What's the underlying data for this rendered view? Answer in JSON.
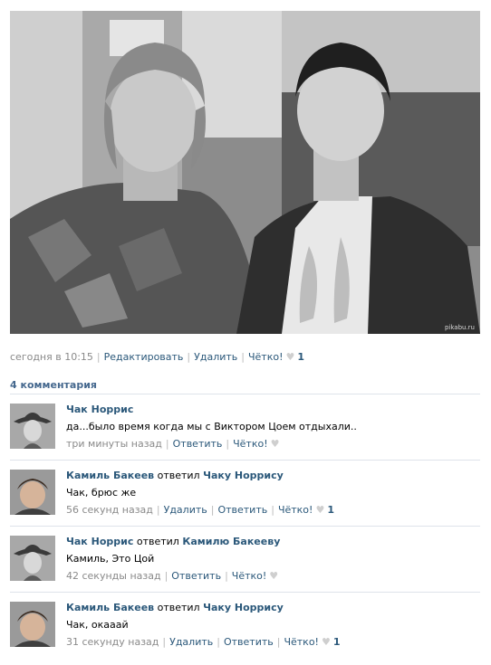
{
  "post": {
    "photo_credit": "pikabu.ru",
    "time": "сегодня в 10:15",
    "edit": "Редактировать",
    "delete": "Удалить",
    "like": "Чётко!",
    "likes_count": "1"
  },
  "comments_title": "4 комментария",
  "comments": [
    {
      "author": "Чак Норрис",
      "reply_word": "",
      "reply_to": "",
      "text": "да...было время когда мы с Виктором Цоем отдыхали..",
      "time": "три минуты назад",
      "delete": "",
      "reply": "Ответить",
      "like": "Чётко!",
      "likes": ""
    },
    {
      "author": "Камиль Бакеев",
      "reply_word": "ответил",
      "reply_to": "Чаку Норрису",
      "text": "Чак, брюс же",
      "time": "56 секунд назад",
      "delete": "Удалить",
      "reply": "Ответить",
      "like": "Чётко!",
      "likes": "1"
    },
    {
      "author": "Чак Норрис",
      "reply_word": "ответил",
      "reply_to": "Камилю Бакееву",
      "text": "Камиль, Это Цой",
      "time": "42 секунды назад",
      "delete": "",
      "reply": "Ответить",
      "like": "Чётко!",
      "likes": ""
    },
    {
      "author": "Камиль Бакеев",
      "reply_word": "ответил",
      "reply_to": "Чаку Норрису",
      "text": "Чак, окааай",
      "time": "31 секунду назад",
      "delete": "Удалить",
      "reply": "Ответить",
      "like": "Чётко!",
      "likes": "1"
    }
  ],
  "colors": {
    "link": "#2b587a",
    "title": "#45688e",
    "meta": "#8a8a8a",
    "divider": "#dee3ea"
  },
  "icons": {
    "heart": "heart-icon"
  }
}
